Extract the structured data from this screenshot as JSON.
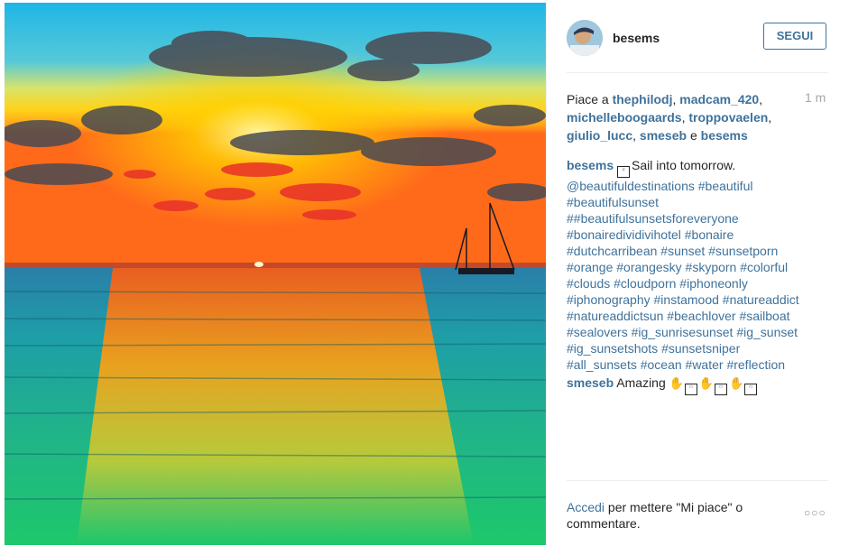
{
  "post": {
    "author": "besems",
    "follow_label": "SEGUI",
    "likes_prefix": "Piace a",
    "likers": [
      "thephilodj",
      "madcam_420",
      "michelleboogaards",
      "troppovaelen",
      "giulio_lucc",
      "smeseb",
      "besems"
    ],
    "likes_and": "e",
    "time_ago": "1 m",
    "caption": {
      "user": "besems",
      "text": "Sail into tomorrow.",
      "tags_line1": "@beautifuldestinations #beautiful",
      "tags_line2": "#beautifulsunset",
      "tags_line3": "##beautifulsunsetsforeveryone",
      "tags_line4": "#bonairedividivihotel #bonaire",
      "tags_line5": "#dutchcarribean #sunset #sunsetporn",
      "tags_line6": "#orange #orangesky #skyporn #colorful",
      "tags_line7": "#clouds #cloudporn #iphoneonly",
      "tags_line8": "#iphonography #instamood #natureaddict",
      "tags_line9": "#natureaddictsun #beachlover #sailboat",
      "tags_line10": "#sealovers #ig_sunrisesunset #ig_sunset",
      "tags_line11": "#ig_sunsetshots #sunsetsniper",
      "tags_line12": "#all_sunsets #ocean #water #reflection"
    },
    "comment": {
      "user": "smeseb",
      "text": "Amazing"
    },
    "footer": {
      "login_link": "Accedi",
      "login_text": "per mettere \"Mi piace\" o commentare.",
      "more_icon": "ellipsis-icon"
    }
  },
  "colors": {
    "link": "#3f729b",
    "text": "#262626",
    "muted": "#a5a7aa",
    "border": "#efefef"
  }
}
